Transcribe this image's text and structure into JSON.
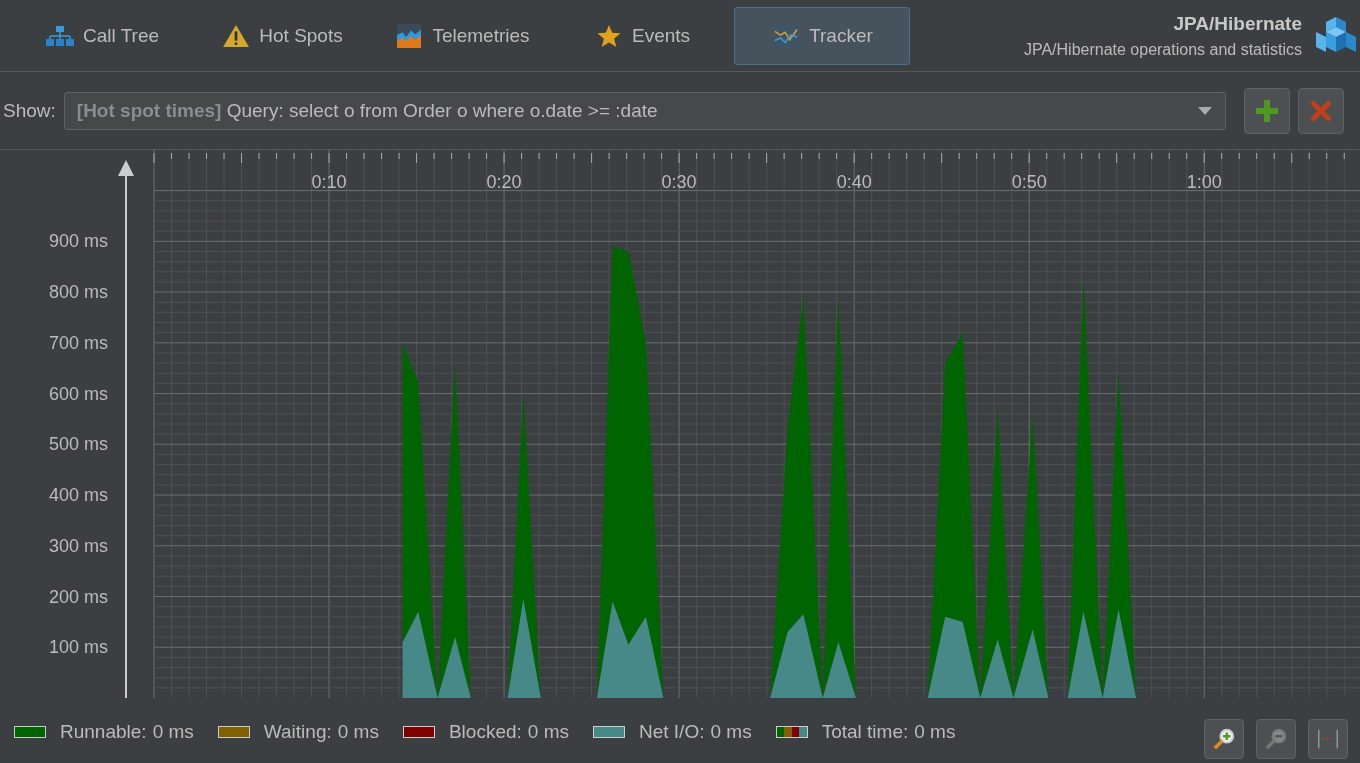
{
  "tabs": [
    {
      "label": "Call Tree",
      "selected": false
    },
    {
      "label": "Hot Spots",
      "selected": false
    },
    {
      "label": "Telemetries",
      "selected": false
    },
    {
      "label": "Events",
      "selected": false
    },
    {
      "label": "Tracker",
      "selected": true
    }
  ],
  "header": {
    "title": "JPA/Hibernate",
    "subtitle": "JPA/Hibernate operations and statistics"
  },
  "show": {
    "label": "Show:",
    "value": "**[Hot spot times]** Query: select o from Order o where o.date >= :date"
  },
  "chart": {
    "chart_data": {
      "type": "area",
      "stacked": true,
      "grid": true,
      "xlim": [
        -8.8,
        68.9
      ],
      "ylim": [
        0,
        1080
      ],
      "x": [
        14.2,
        15.1,
        16.2,
        17.2,
        18.1,
        20.2,
        21.1,
        22.1,
        25.3,
        26.2,
        27.1,
        28.1,
        29.1,
        35.2,
        36.2,
        37.1,
        38.2,
        39.1,
        40.1,
        44.2,
        45.2,
        46.2,
        47.2,
        48.2,
        49.1,
        50.2,
        51.1,
        52.2,
        53.1,
        54.2,
        55.1,
        56.1
      ],
      "series": [
        {
          "name": "Runnable:",
          "color": "#006400",
          "values": [
            590,
            450,
            0,
            540,
            0,
            0,
            405,
            0,
            0,
            700,
            775,
            540,
            0,
            0,
            400,
            625,
            0,
            680,
            0,
            0,
            500,
            570,
            0,
            455,
            0,
            425,
            0,
            0,
            660,
            0,
            465,
            0
          ]
        },
        {
          "name": "Net I/O:",
          "color": "#478989",
          "values": [
            110,
            170,
            0,
            120,
            0,
            0,
            195,
            0,
            0,
            190,
            105,
            160,
            0,
            0,
            130,
            165,
            0,
            110,
            0,
            0,
            160,
            150,
            0,
            115,
            0,
            135,
            0,
            0,
            170,
            0,
            175,
            0
          ]
        }
      ],
      "xticks": [
        {
          "value": 10,
          "label": "0:10"
        },
        {
          "value": 20,
          "label": "0:20"
        },
        {
          "value": 30,
          "label": "0:30"
        },
        {
          "value": 40,
          "label": "0:40"
        },
        {
          "value": 50,
          "label": "0:50"
        },
        {
          "value": 60,
          "label": "1:00"
        }
      ],
      "yticks": [
        {
          "value": 100,
          "label": "100 ms"
        },
        {
          "value": 200,
          "label": "200 ms"
        },
        {
          "value": 300,
          "label": "300 ms"
        },
        {
          "value": 400,
          "label": "400 ms"
        },
        {
          "value": 500,
          "label": "500 ms"
        },
        {
          "value": 600,
          "label": "600 ms"
        },
        {
          "value": 700,
          "label": "700 ms"
        },
        {
          "value": 800,
          "label": "800 ms"
        },
        {
          "value": 900,
          "label": "900 ms"
        }
      ]
    }
  },
  "legend": [
    {
      "kind": "series",
      "value": "0 ms"
    },
    {
      "kind": "swatch",
      "label": "Waiting:",
      "value": "0 ms",
      "color": "#806000"
    },
    {
      "kind": "swatch",
      "label": "Blocked:",
      "value": "0 ms",
      "color": "#800000"
    },
    {
      "kind": "series",
      "value": "0 ms"
    },
    {
      "kind": "multi",
      "label": "Total time:",
      "value": "0 ms"
    }
  ]
}
